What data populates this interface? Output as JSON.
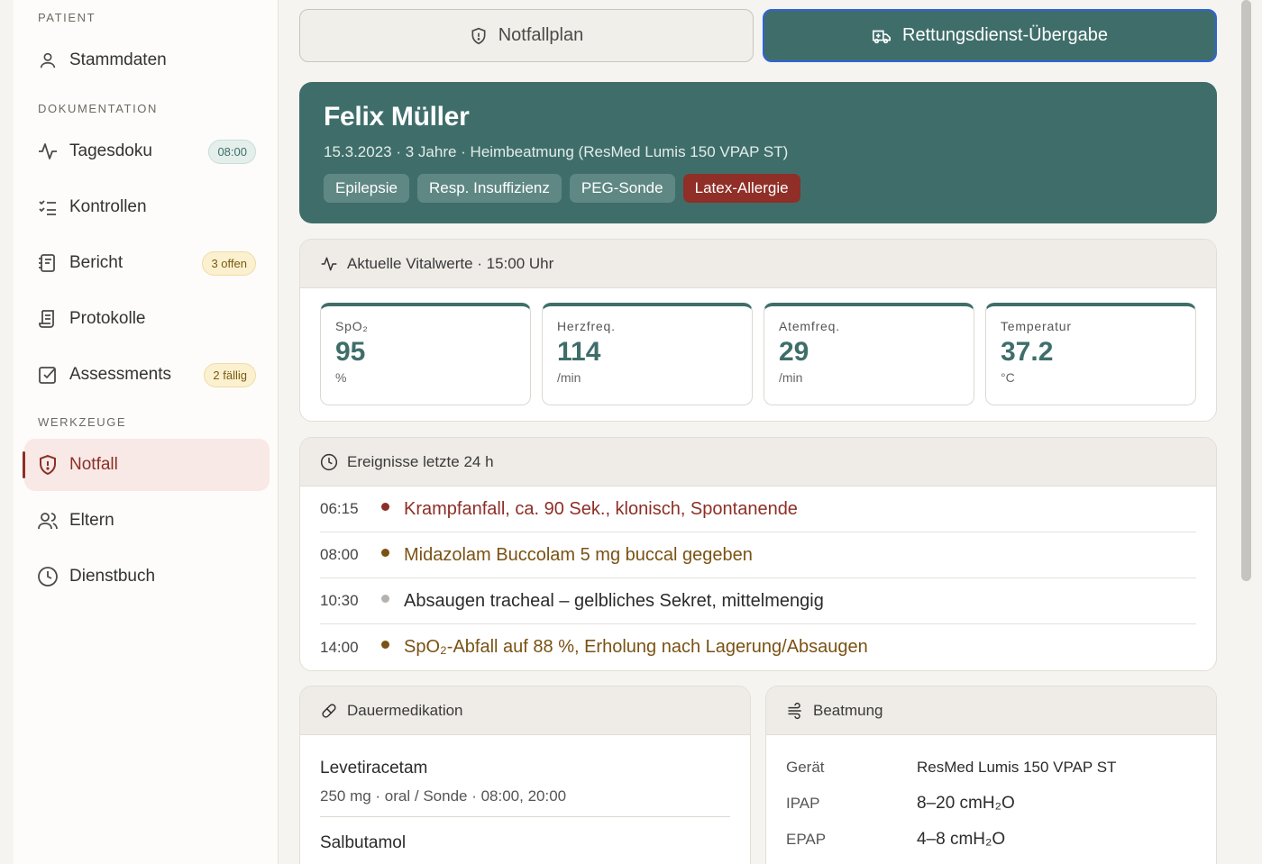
{
  "sidebar": {
    "sections": {
      "patient": "PATIENT",
      "documentation": "DOKUMENTATION",
      "tools": "WERKZEUGE"
    },
    "items": [
      {
        "label": "Stammdaten",
        "icon": "user-icon"
      },
      {
        "label": "Tagesdoku",
        "icon": "activity-icon",
        "badge": "08:00"
      },
      {
        "label": "Kontrollen",
        "icon": "checklist-icon"
      },
      {
        "label": "Bericht",
        "icon": "notebook-icon",
        "badge": "3 offen"
      },
      {
        "label": "Protokolle",
        "icon": "scroll-icon"
      },
      {
        "label": "Assessments",
        "icon": "check-square-icon",
        "badge": "2 fällig"
      },
      {
        "label": "Notfall",
        "icon": "shield-alert-icon",
        "active": true
      },
      {
        "label": "Eltern",
        "icon": "users-icon"
      },
      {
        "label": "Dienstbuch",
        "icon": "clock-icon"
      }
    ]
  },
  "actions": {
    "plan": "Notfallplan",
    "handover": "Rettungsdienst-Übergabe"
  },
  "patient": {
    "name": "Felix Müller",
    "meta": "15.3.2023 · 3 Jahre · Heimbeatmung (ResMed Lumis 150 VPAP ST)",
    "tags": [
      "Epilepsie",
      "Resp. Insuffizienz",
      "PEG-Sonde",
      "Latex-Allergie"
    ]
  },
  "vitals": {
    "title": "Aktuelle Vitalwerte · 15:00 Uhr",
    "items": [
      {
        "label": "SpO₂",
        "value": "95",
        "unit": "%"
      },
      {
        "label": "Herzfreq.",
        "value": "114",
        "unit": "/min"
      },
      {
        "label": "Atemfreq.",
        "value": "29",
        "unit": "/min"
      },
      {
        "label": "Temperatur",
        "value": "37.2",
        "unit": "°C"
      }
    ]
  },
  "events": {
    "title": "Ereignisse letzte 24 h",
    "items": [
      {
        "time": "06:15",
        "text": "Krampfanfall, ca. 90 Sek., klonisch, Spontanende",
        "color": "#8c2f27"
      },
      {
        "time": "08:00",
        "text": "Midazolam Buccolam 5 mg buccal gegeben",
        "color": "#7a5214"
      },
      {
        "time": "10:30",
        "text": "Absaugen tracheal – gelbliches Sekret, mittelmengig",
        "color": "#2b2b2b",
        "dot": "#b5b2ad"
      },
      {
        "time": "14:00",
        "text": "SpO₂-Abfall auf 88 %, Erholung nach Lagerung/Absaugen",
        "color": "#7a5214"
      }
    ]
  },
  "medication": {
    "title": "Dauermedikation",
    "items": [
      {
        "name": "Levetiracetam",
        "detail": "250 mg · oral / Sonde · 08:00, 20:00"
      },
      {
        "name": "Salbutamol",
        "detail": ""
      }
    ]
  },
  "ventilation": {
    "title": "Beatmung",
    "rows": [
      {
        "key": "Gerät",
        "value": "ResMed Lumis 150 VPAP ST"
      },
      {
        "key": "IPAP",
        "value": "8–20 cmH₂O"
      },
      {
        "key": "EPAP",
        "value": "4–8 cmH₂O"
      }
    ]
  },
  "colors": {
    "accent": "#3f6e6a",
    "danger": "#8c2f27",
    "warning": "#7a5214"
  }
}
